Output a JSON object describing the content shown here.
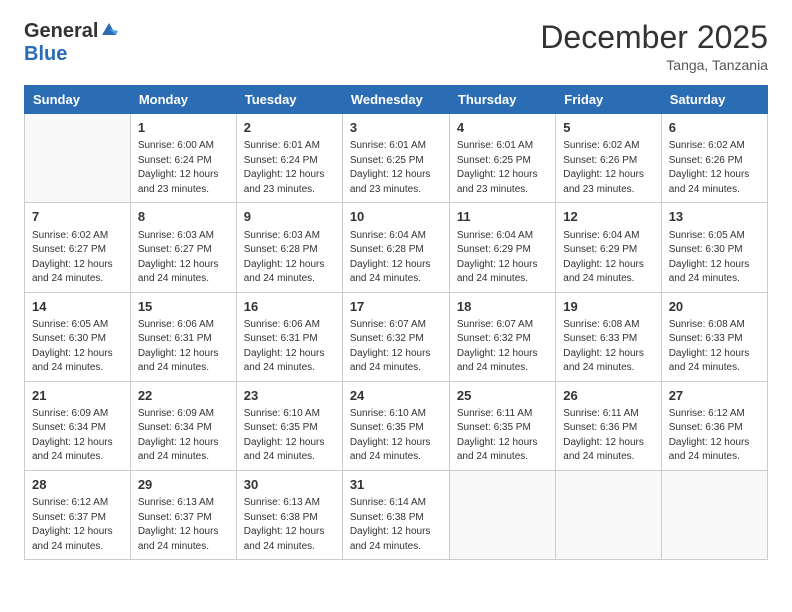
{
  "header": {
    "logo_general": "General",
    "logo_blue": "Blue",
    "month_title": "December 2025",
    "subtitle": "Tanga, Tanzania"
  },
  "days_of_week": [
    "Sunday",
    "Monday",
    "Tuesday",
    "Wednesday",
    "Thursday",
    "Friday",
    "Saturday"
  ],
  "weeks": [
    [
      {
        "day": "",
        "sunrise": "",
        "sunset": "",
        "daylight": ""
      },
      {
        "day": "1",
        "sunrise": "6:00 AM",
        "sunset": "6:24 PM",
        "daylight": "12 hours and 23 minutes."
      },
      {
        "day": "2",
        "sunrise": "6:01 AM",
        "sunset": "6:24 PM",
        "daylight": "12 hours and 23 minutes."
      },
      {
        "day": "3",
        "sunrise": "6:01 AM",
        "sunset": "6:25 PM",
        "daylight": "12 hours and 23 minutes."
      },
      {
        "day": "4",
        "sunrise": "6:01 AM",
        "sunset": "6:25 PM",
        "daylight": "12 hours and 23 minutes."
      },
      {
        "day": "5",
        "sunrise": "6:02 AM",
        "sunset": "6:26 PM",
        "daylight": "12 hours and 23 minutes."
      },
      {
        "day": "6",
        "sunrise": "6:02 AM",
        "sunset": "6:26 PM",
        "daylight": "12 hours and 24 minutes."
      }
    ],
    [
      {
        "day": "7",
        "sunrise": "6:02 AM",
        "sunset": "6:27 PM",
        "daylight": "12 hours and 24 minutes."
      },
      {
        "day": "8",
        "sunrise": "6:03 AM",
        "sunset": "6:27 PM",
        "daylight": "12 hours and 24 minutes."
      },
      {
        "day": "9",
        "sunrise": "6:03 AM",
        "sunset": "6:28 PM",
        "daylight": "12 hours and 24 minutes."
      },
      {
        "day": "10",
        "sunrise": "6:04 AM",
        "sunset": "6:28 PM",
        "daylight": "12 hours and 24 minutes."
      },
      {
        "day": "11",
        "sunrise": "6:04 AM",
        "sunset": "6:29 PM",
        "daylight": "12 hours and 24 minutes."
      },
      {
        "day": "12",
        "sunrise": "6:04 AM",
        "sunset": "6:29 PM",
        "daylight": "12 hours and 24 minutes."
      },
      {
        "day": "13",
        "sunrise": "6:05 AM",
        "sunset": "6:30 PM",
        "daylight": "12 hours and 24 minutes."
      }
    ],
    [
      {
        "day": "14",
        "sunrise": "6:05 AM",
        "sunset": "6:30 PM",
        "daylight": "12 hours and 24 minutes."
      },
      {
        "day": "15",
        "sunrise": "6:06 AM",
        "sunset": "6:31 PM",
        "daylight": "12 hours and 24 minutes."
      },
      {
        "day": "16",
        "sunrise": "6:06 AM",
        "sunset": "6:31 PM",
        "daylight": "12 hours and 24 minutes."
      },
      {
        "day": "17",
        "sunrise": "6:07 AM",
        "sunset": "6:32 PM",
        "daylight": "12 hours and 24 minutes."
      },
      {
        "day": "18",
        "sunrise": "6:07 AM",
        "sunset": "6:32 PM",
        "daylight": "12 hours and 24 minutes."
      },
      {
        "day": "19",
        "sunrise": "6:08 AM",
        "sunset": "6:33 PM",
        "daylight": "12 hours and 24 minutes."
      },
      {
        "day": "20",
        "sunrise": "6:08 AM",
        "sunset": "6:33 PM",
        "daylight": "12 hours and 24 minutes."
      }
    ],
    [
      {
        "day": "21",
        "sunrise": "6:09 AM",
        "sunset": "6:34 PM",
        "daylight": "12 hours and 24 minutes."
      },
      {
        "day": "22",
        "sunrise": "6:09 AM",
        "sunset": "6:34 PM",
        "daylight": "12 hours and 24 minutes."
      },
      {
        "day": "23",
        "sunrise": "6:10 AM",
        "sunset": "6:35 PM",
        "daylight": "12 hours and 24 minutes."
      },
      {
        "day": "24",
        "sunrise": "6:10 AM",
        "sunset": "6:35 PM",
        "daylight": "12 hours and 24 minutes."
      },
      {
        "day": "25",
        "sunrise": "6:11 AM",
        "sunset": "6:35 PM",
        "daylight": "12 hours and 24 minutes."
      },
      {
        "day": "26",
        "sunrise": "6:11 AM",
        "sunset": "6:36 PM",
        "daylight": "12 hours and 24 minutes."
      },
      {
        "day": "27",
        "sunrise": "6:12 AM",
        "sunset": "6:36 PM",
        "daylight": "12 hours and 24 minutes."
      }
    ],
    [
      {
        "day": "28",
        "sunrise": "6:12 AM",
        "sunset": "6:37 PM",
        "daylight": "12 hours and 24 minutes."
      },
      {
        "day": "29",
        "sunrise": "6:13 AM",
        "sunset": "6:37 PM",
        "daylight": "12 hours and 24 minutes."
      },
      {
        "day": "30",
        "sunrise": "6:13 AM",
        "sunset": "6:38 PM",
        "daylight": "12 hours and 24 minutes."
      },
      {
        "day": "31",
        "sunrise": "6:14 AM",
        "sunset": "6:38 PM",
        "daylight": "12 hours and 24 minutes."
      },
      {
        "day": "",
        "sunrise": "",
        "sunset": "",
        "daylight": ""
      },
      {
        "day": "",
        "sunrise": "",
        "sunset": "",
        "daylight": ""
      },
      {
        "day": "",
        "sunrise": "",
        "sunset": "",
        "daylight": ""
      }
    ]
  ]
}
